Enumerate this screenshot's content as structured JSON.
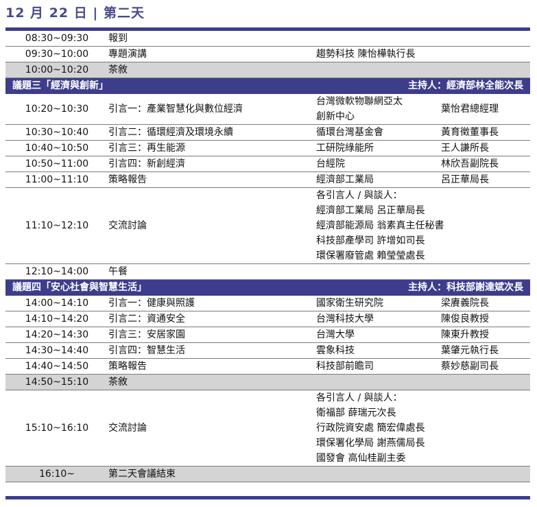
{
  "header": {
    "date": "12 月 22 日",
    "separator": "|",
    "day": "第二天"
  },
  "rows": [
    {
      "time": "08:30~09:30",
      "topic": "報到",
      "org": "",
      "person": ""
    },
    {
      "time": "09:30~10:00",
      "topic": "專題演講",
      "org": "趨勢科技  陳怡樺執行長",
      "person": ""
    },
    {
      "time": "10:00~10:20",
      "topic": "茶敘",
      "org": "",
      "person": ""
    }
  ],
  "section3": {
    "title": "議題三「經濟與創新」",
    "host": "主持人：經濟部林全能次長",
    "rows": [
      {
        "time": "10:20~10:30",
        "topic": "引言一：產業智慧化與數位經濟",
        "org_lines": [
          "台灣微軟物聯網亞太",
          "創新中心"
        ],
        "person": "葉怡君總經理"
      },
      {
        "time": "10:30~10:40",
        "topic": "引言二：循環經濟及環境永續",
        "org": "循環台灣基金會",
        "person": "黃育徵董事長"
      },
      {
        "time": "10:40~10:50",
        "topic": "引言三：再生能源",
        "org": "工研院綠能所",
        "person": "王人謙所長"
      },
      {
        "time": "10:50~11:00",
        "topic": "引言四：新創經濟",
        "org": "台經院",
        "person": "林欣吾副院長"
      },
      {
        "time": "11:00~11:10",
        "topic": "策略報告",
        "org": "經濟部工業局",
        "person": "呂正華局長"
      }
    ],
    "discussion": {
      "time": "11:10~12:10",
      "topic": "交流討論",
      "lines": [
        "各引言人 / 與談人：",
        "經濟部工業局  呂正華局長",
        "經濟部能源局  翁素真主任秘書",
        "科技部產學司  許增如司長",
        "環保署廢管處  賴瑩瑩處長"
      ]
    },
    "lunch": {
      "time": "12:10~14:00",
      "topic": "午餐"
    }
  },
  "section4": {
    "title": "議題四「安心社會與智慧生活」",
    "host": "主持人：科技部謝達斌次長",
    "rows": [
      {
        "time": "14:00~14:10",
        "topic": "引言一：健康與照護",
        "org": "國家衛生研究院",
        "person": "梁賡義院長"
      },
      {
        "time": "14:10~14:20",
        "topic": "引言二：資通安全",
        "org": "台灣科技大學",
        "person": "陳俊良教授"
      },
      {
        "time": "14:20~14:30",
        "topic": "引言三：安居家園",
        "org": "台灣大學",
        "person": "陳東升教授"
      },
      {
        "time": "14:30~14:40",
        "topic": "引言四：智慧生活",
        "org": "雲象科技",
        "person": "葉肇元執行長"
      },
      {
        "time": "14:40~14:50",
        "topic": "策略報告",
        "org": "科技部前瞻司",
        "person": "蔡妙慈副司長"
      }
    ],
    "tea": {
      "time": "14:50~15:10",
      "topic": "茶敘"
    },
    "discussion": {
      "time": "15:10~16:10",
      "topic": "交流討論",
      "lines": [
        "各引言人 / 與談人：",
        "衛福部  薛瑞元次長",
        "行政院資安處  簡宏偉處長",
        "環保署化學局  謝燕儒局長",
        "國發會  高仙桂副主委"
      ]
    },
    "end": {
      "time": "16:10~",
      "topic": "第二天會議結束"
    }
  },
  "colors": {
    "accent": "#3d3d8c",
    "title": "#4a4a8c",
    "gray_row": "#d4d4d4"
  }
}
